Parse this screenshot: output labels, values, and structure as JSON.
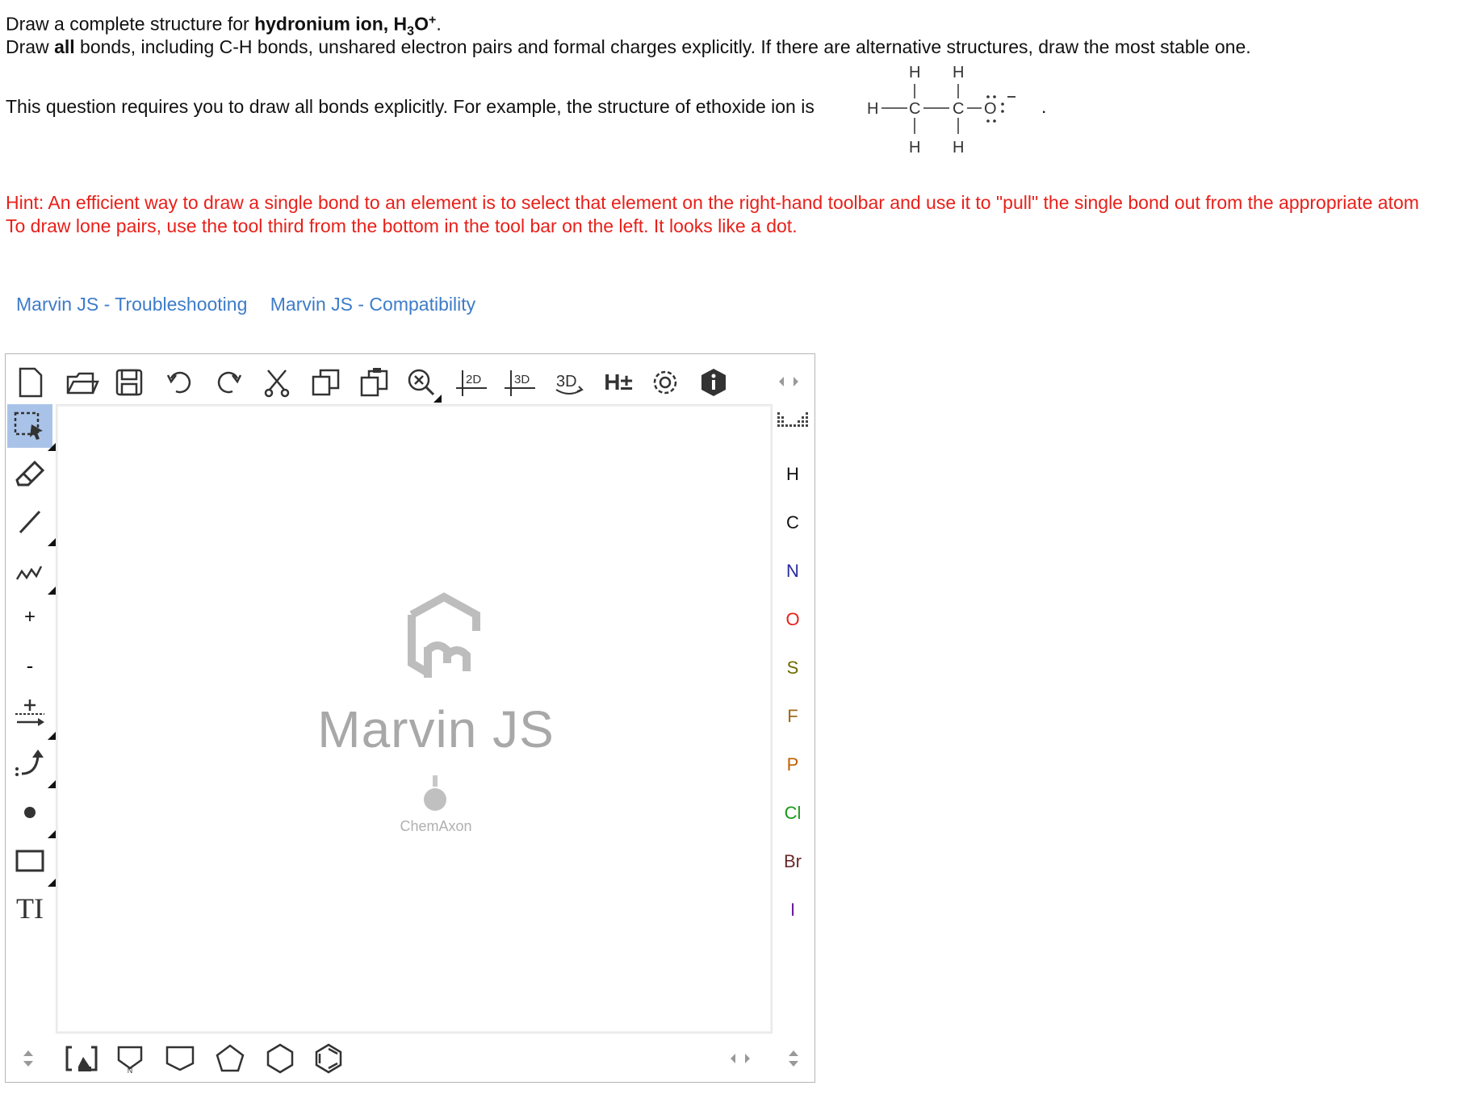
{
  "question": {
    "line1_pre": "Draw a complete structure for ",
    "line1_bold": "hydronium ion, H",
    "line1_sub": "3",
    "line1_bold2": "O",
    "line1_sup": "+",
    "line1_end": ".",
    "line2_pre": "Draw ",
    "line2_bold": "all",
    "line2_rest": " bonds, including C-H bonds, unshared electron pairs and formal charges explicitly. If there are alternative structures, draw the most stable one.",
    "line3": "This question requires you to draw all bonds explicitly. For example, the structure of ethoxide ion is",
    "line3_end": "."
  },
  "example_structure": {
    "atoms": [
      "H",
      "C",
      "C",
      "O",
      "H",
      "H",
      "H",
      "H"
    ],
    "charge": "−"
  },
  "hint": {
    "line1": "Hint: An efficient way to draw a single bond to an element is to select that element on the right-hand toolbar and use it to \"pull\" the single bond out from the appropriate atom",
    "line2": "To draw lone pairs, use the tool third from the bottom in the tool bar on the left. It looks like a dot."
  },
  "links": [
    "Marvin JS - Troubleshooting",
    "Marvin JS - Compatibility"
  ],
  "editor": {
    "top_toolbar": [
      "new-document-icon",
      "open-icon",
      "save-icon",
      "undo-icon",
      "redo-icon",
      "cut-icon",
      "copy-icon",
      "paste-icon",
      "zoom-icon",
      "clean-2d-icon",
      "clean-3d-icon",
      "3d-view-icon",
      "explicit-hydrogens-icon",
      "settings-icon",
      "info-icon"
    ],
    "top_toolbar_labels": {
      "clean2d": "2D",
      "clean3d": "3D",
      "view3d": "3D",
      "hydrogens": "H±"
    },
    "left_toolbar": [
      "select-icon",
      "erase-icon",
      "single-bond-icon",
      "chain-icon",
      "positive-charge-icon",
      "negative-charge-icon",
      "reaction-arrow-icon",
      "curved-arrow-icon",
      "lone-pair-dot-icon",
      "rectangle-shape-icon",
      "text-tool-icon"
    ],
    "left_labels": {
      "plus": "+",
      "minus": "-",
      "text": "TI"
    },
    "elements": [
      {
        "symbol": "H",
        "color": "#333333"
      },
      {
        "symbol": "C",
        "color": "#333333"
      },
      {
        "symbol": "N",
        "color": "#2a2a9c"
      },
      {
        "symbol": "O",
        "color": "#e8201a"
      },
      {
        "symbol": "S",
        "color": "#6b6b00"
      },
      {
        "symbol": "F",
        "color": "#a06a1a"
      },
      {
        "symbol": "P",
        "color": "#c06000"
      },
      {
        "symbol": "Cl",
        "color": "#1a9a1a"
      },
      {
        "symbol": "Br",
        "color": "#6b2a2a"
      },
      {
        "symbol": "I",
        "color": "#6a1a9a"
      }
    ],
    "bottom_toolbar": [
      "template-library-icon",
      "benzene-template-icon",
      "cyclopropane-icon",
      "cyclobutane-icon",
      "cyclopentane-icon",
      "cyclohexane-icon",
      "benzene-icon"
    ],
    "watermark_title": "Marvin JS",
    "watermark_sub": "ChemAxon"
  }
}
